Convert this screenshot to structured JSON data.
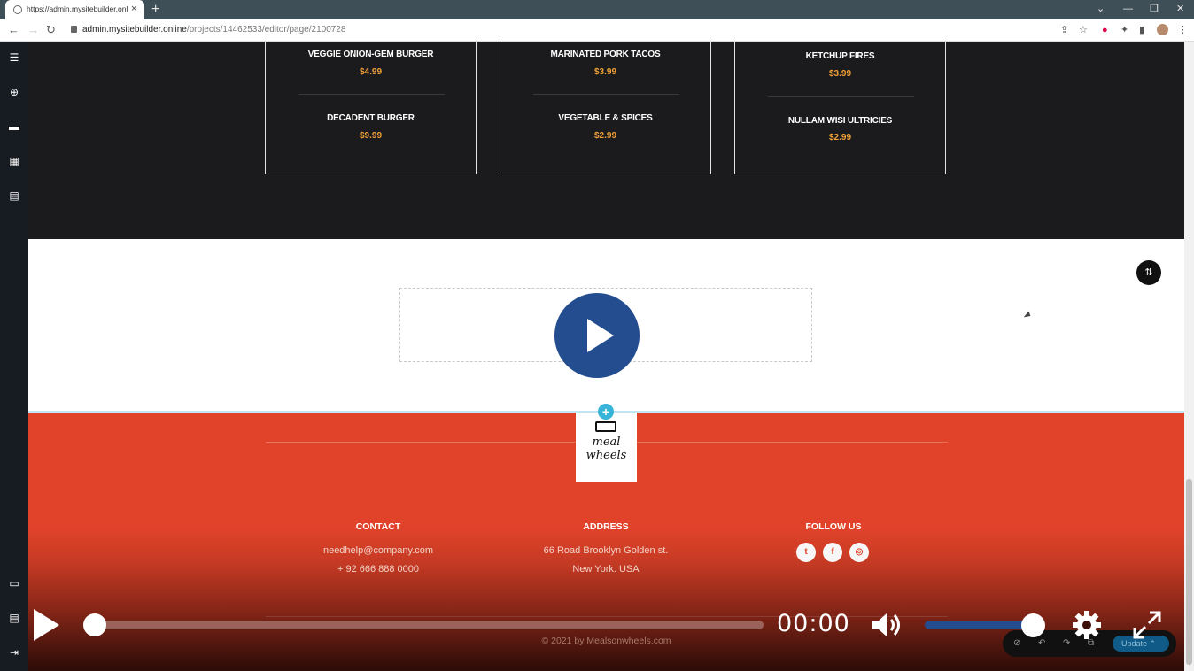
{
  "browser": {
    "tab_title": "https://admin.mysitebuilder.onlin",
    "tab_close": "×",
    "new_tab": "+",
    "url_host": "admin.mysitebuilder.online",
    "url_path": "/projects/14462533/editor/page/2100728"
  },
  "menu": {
    "columns": [
      {
        "items": [
          {
            "name": "VEGGIE ONION-GEM BURGER",
            "price": "$4.99"
          },
          {
            "name": "DECADENT BURGER",
            "price": "$9.99"
          }
        ]
      },
      {
        "items": [
          {
            "name": "MARINATED PORK TACOS",
            "price": "$3.99"
          },
          {
            "name": "VEGETABLE & SPICES",
            "price": "$2.99"
          }
        ]
      },
      {
        "items": [
          {
            "name": "KETCHUP FIRES",
            "price": "$3.99"
          },
          {
            "name": "NULLAM WISI ULTRICIES",
            "price": "$2.99"
          }
        ]
      }
    ]
  },
  "footer": {
    "logo_line1": "meal",
    "logo_line2": "wheels",
    "contact": {
      "heading": "CONTACT",
      "email": "needhelp@company.com",
      "phone": "+ 92 666 888 0000"
    },
    "address": {
      "heading": "ADDRESS",
      "line1": "66 Road Brooklyn Golden st.",
      "line2": "New York. USA"
    },
    "follow": {
      "heading": "FOLLOW US",
      "icons": [
        "twitter-icon",
        "facebook-icon",
        "instagram-icon"
      ]
    },
    "copyright": "© 2021 by Mealsonwheels.com"
  },
  "editor_toolbar": {
    "update_label": "Update"
  },
  "player": {
    "time": "00:00",
    "progress": 0,
    "volume": 0.9
  },
  "colors": {
    "accent_red": "#e1432a",
    "price_orange": "#f1a13a",
    "player_blue": "#234d8e"
  }
}
